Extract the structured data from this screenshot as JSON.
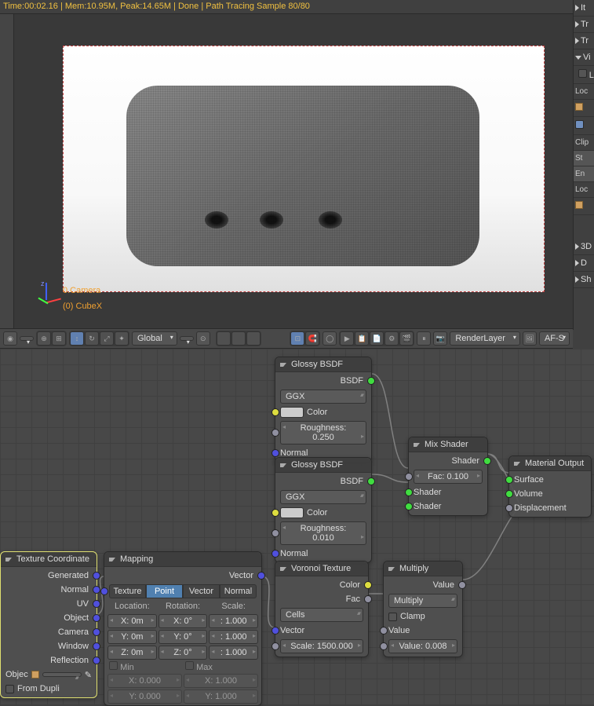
{
  "status_line": "Time:00:02.16 | Mem:10.95M, Peak:14.65M | Done | Path Tracing Sample 80/80",
  "viewport": {
    "camera_label": "0.Camera",
    "object_label": "(0) CubeX",
    "axes": {
      "z": "z",
      "y": "y",
      "x": "x"
    }
  },
  "header": {
    "orientation": "Global",
    "render_layer": "RenderLayer",
    "camera_mode": "AF-S"
  },
  "right_panel": {
    "items": [
      "It",
      "Tr",
      "Tr",
      "Vi",
      "Le"
    ],
    "section_lock": "Loc",
    "clip": "Clip",
    "sta": "St",
    "en": "En",
    "loc2": "Loc",
    "bottom": [
      "3D",
      "D",
      "Sh"
    ]
  },
  "nodes": {
    "glossy1": {
      "title": "Glossy BSDF",
      "bsdf_out": "BSDF",
      "distribution": "GGX",
      "color_label": "Color",
      "roughness": "Roughness: 0.250",
      "normal": "Normal"
    },
    "glossy2": {
      "title": "Glossy BSDF",
      "bsdf_out": "BSDF",
      "distribution": "GGX",
      "color_label": "Color",
      "roughness": "Roughness: 0.010",
      "normal": "Normal"
    },
    "mix": {
      "title": "Mix Shader",
      "shader_out": "Shader",
      "fac_label": "Fac:",
      "fac_val": "0.100",
      "shader1": "Shader",
      "shader2": "Shader"
    },
    "output": {
      "title": "Material Output",
      "surface": "Surface",
      "volume": "Volume",
      "displacement": "Displacement"
    },
    "texcoord": {
      "title": "Texture Coordinate",
      "outputs": [
        "Generated",
        "Normal",
        "UV",
        "Object",
        "Camera",
        "Window",
        "Reflection"
      ],
      "object_label": "Objec",
      "from_dupli": "From Dupli"
    },
    "mapping": {
      "title": "Mapping",
      "vector_out": "Vector",
      "tabs": [
        "Texture",
        "Point",
        "Vector",
        "Normal"
      ],
      "loc_label": "Location:",
      "rot_label": "Rotation:",
      "scale_label": "Scale:",
      "x0": "X: 0m",
      "rx0": "X: 0°",
      "sx1": ": 1.000",
      "y0": "Y: 0m",
      "ry0": "Y: 0°",
      "sy1": ": 1.000",
      "z0": "Z: 0m",
      "rz0": "Z: 0°",
      "sz1": ": 1.000",
      "min": "Min",
      "max": "Max",
      "mx0": "X: 0.000",
      "my0": "Y: 0.000",
      "Mx1": "X: 1.000",
      "My1": "Y: 1.000"
    },
    "voronoi": {
      "title": "Voronoi Texture",
      "color_out": "Color",
      "fac_out": "Fac",
      "coloring": "Cells",
      "vector_in": "Vector",
      "scale": "Scale: 1500.000"
    },
    "multiply": {
      "title": "Multiply",
      "value_out": "Value",
      "operation": "Multiply",
      "clamp": "Clamp",
      "value1": "Value",
      "value2": "Value:",
      "value2_num": "0.008"
    }
  }
}
